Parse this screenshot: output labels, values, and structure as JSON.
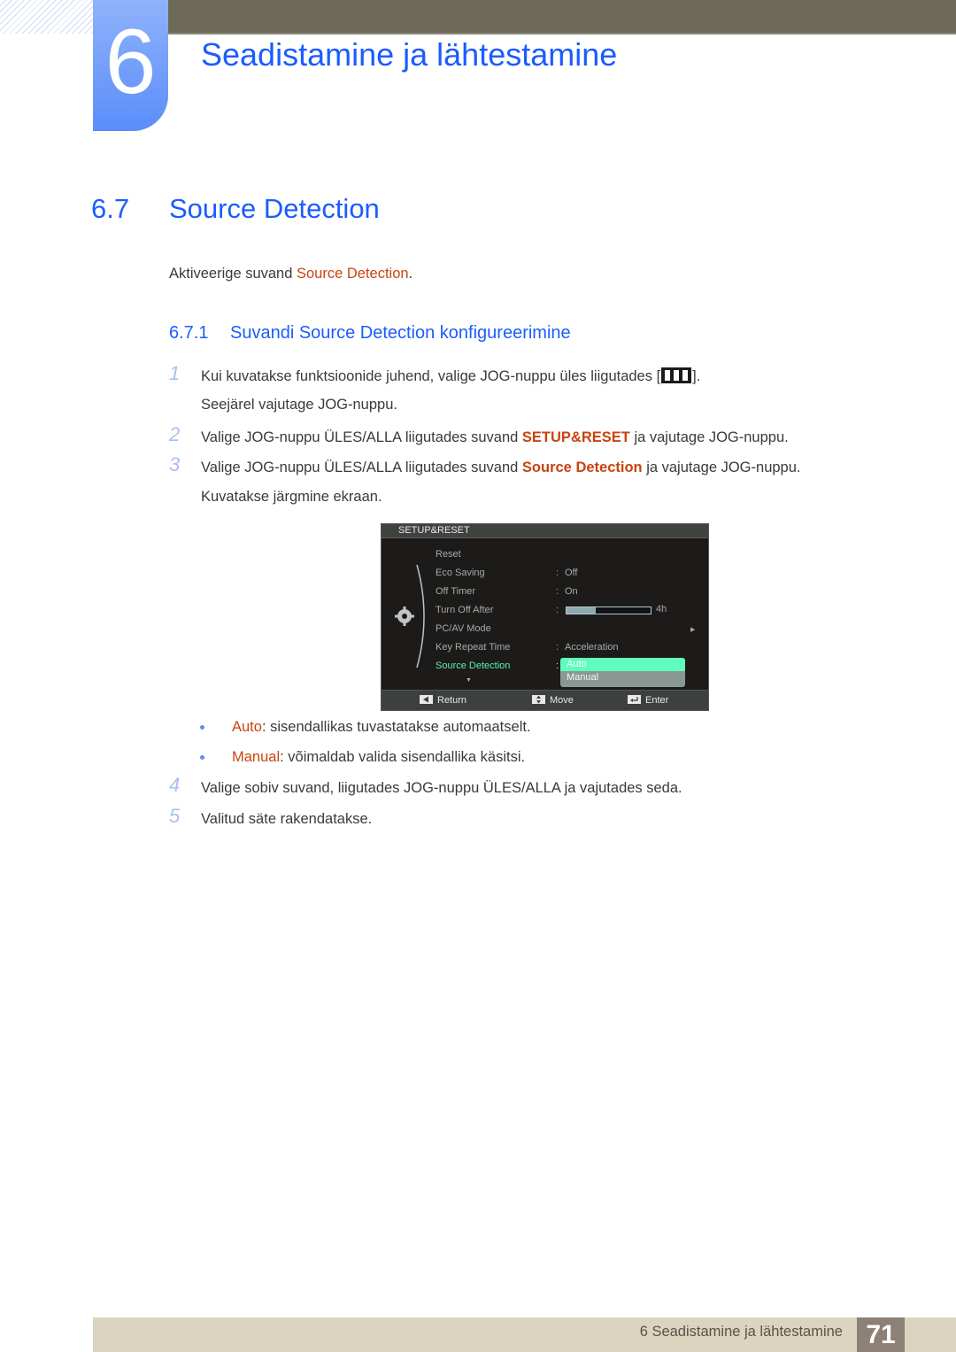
{
  "header": {
    "chapter_number": "6",
    "chapter_title": "Seadistamine ja lähtestamine"
  },
  "section": {
    "number": "6.7",
    "title": "Source Detection",
    "intro_prefix": "Aktiveerige suvand ",
    "intro_highlight": "Source Detection",
    "intro_suffix": "."
  },
  "subsection": {
    "number": "6.7.1",
    "title": "Suvandi Source Detection konfigureerimine"
  },
  "steps": [
    {
      "num": "1",
      "line1_prefix": "Kui kuvatakse funktsioonide juhend, valige JOG-nuppu üles liigutades [",
      "icon": "menu-icon",
      "line1_suffix": "].",
      "line2": "Seejärel vajutage JOG-nuppu."
    },
    {
      "num": "2",
      "prefix": "Valige JOG-nuppu ÜLES/ALLA liigutades suvand ",
      "highlight": "SETUP&RESET",
      "suffix": " ja vajutage JOG-nuppu."
    },
    {
      "num": "3",
      "prefix": "Valige JOG-nuppu ÜLES/ALLA liigutades suvand ",
      "highlight": "Source Detection",
      "suffix": " ja vajutage JOG-nuppu.",
      "line2": "Kuvatakse järgmine ekraan."
    },
    {
      "num": "4",
      "text": "Valige sobiv suvand, liigutades JOG-nuppu ÜLES/ALLA ja vajutades seda."
    },
    {
      "num": "5",
      "text": "Valitud säte rakendatakse."
    }
  ],
  "bullets": [
    {
      "term": "Auto",
      "desc": ": sisendallikas tuvastatakse automaatselt."
    },
    {
      "term": "Manual",
      "desc": ": võimaldab valida sisendallika käsitsi."
    }
  ],
  "osd": {
    "title": "SETUP&RESET",
    "menu_icon": "gear-icon",
    "items": [
      {
        "label": "Reset",
        "value": ""
      },
      {
        "label": "Eco Saving",
        "value": "Off"
      },
      {
        "label": "Off Timer",
        "value": "On"
      },
      {
        "label": "Turn Off After",
        "value": "4h",
        "progress": 0.35
      },
      {
        "label": "PC/AV Mode",
        "value": ""
      },
      {
        "label": "Key Repeat Time",
        "value": "Acceleration"
      },
      {
        "label": "Source Detection",
        "value": ""
      }
    ],
    "active_item": "Source Detection",
    "dropdown_options": [
      "Auto",
      "Manual"
    ],
    "dropdown_selected": "Auto",
    "footer": {
      "return_label": "Return",
      "move_label": "Move",
      "enter_label": "Enter"
    },
    "colors": {
      "active": "#5ff0b5",
      "selected_option": "#5ffcbe"
    }
  },
  "footer": {
    "chapter_text": "6 Seadistamine ja lähtestamine",
    "page_number": "71"
  },
  "colors": {
    "heading_blue": "#1a5cff",
    "highlight_orange": "#c84410",
    "step_number": "#a8bfec"
  }
}
